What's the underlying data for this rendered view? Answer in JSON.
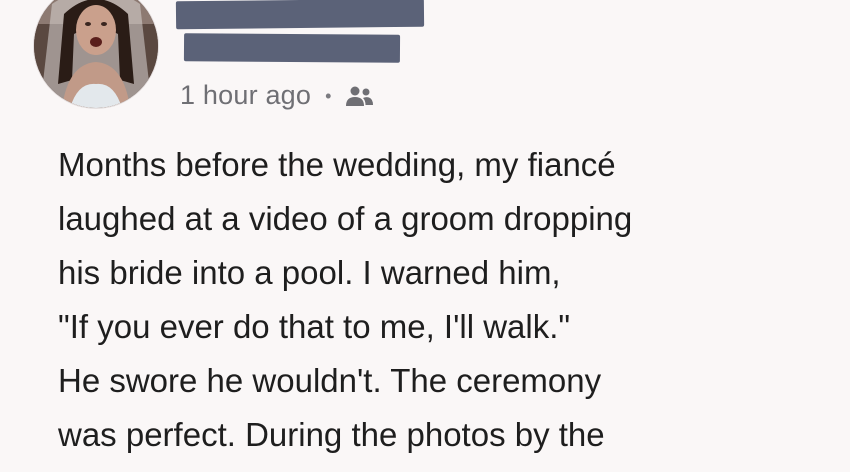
{
  "post": {
    "timestamp": "1 hour ago",
    "separator": "•",
    "audience_icon": "friends-icon",
    "body_lines": [
      "Months before the wedding, my fiancé",
      "laughed at a video of a groom dropping",
      "his bride into a pool. I warned him,",
      "\"If you ever do that to me, I'll walk.\"",
      "He swore he wouldn't. The ceremony",
      "was perfect. During the photos by the"
    ]
  },
  "colors": {
    "background": "#faf7f7",
    "redaction": "#5b6278",
    "meta_text": "#6f6f74",
    "body_text": "#1e1e1e"
  }
}
